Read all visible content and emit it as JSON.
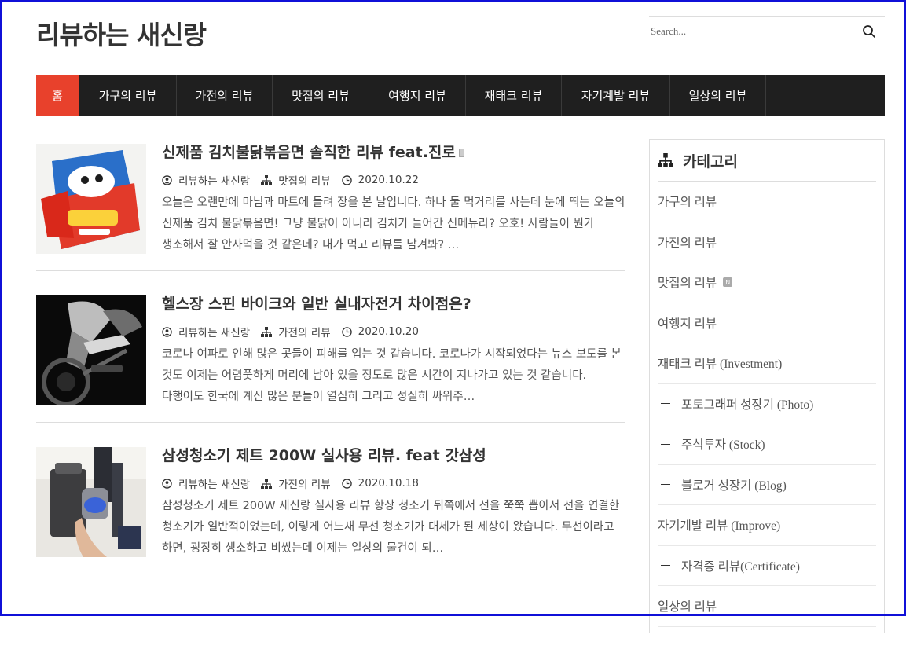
{
  "site": {
    "title": "리뷰하는 새신랑"
  },
  "search": {
    "placeholder": "Search..."
  },
  "nav": {
    "items": [
      {
        "label": "홈",
        "active": true
      },
      {
        "label": "가구의 리뷰"
      },
      {
        "label": "가전의 리뷰"
      },
      {
        "label": "맛집의 리뷰"
      },
      {
        "label": "여행지 리뷰"
      },
      {
        "label": "재태크 리뷰"
      },
      {
        "label": "자기계발 리뷰"
      },
      {
        "label": "일상의 리뷰"
      }
    ]
  },
  "posts": [
    {
      "title": "신제품 김치불닭볶음면 솔직한 리뷰 feat.진로",
      "author": "리뷰하는 새신랑",
      "category": "맛집의 리뷰",
      "date": "2020.10.22",
      "excerpt": "오늘은 오랜만에 마님과 마트에 들려 장을 본 날입니다. 하나 둘 먹거리를 사는데 눈에 띄는 오늘의 신제품 김치 불닭볶음면! 그냥 불닭이 아니라 김치가 들어간 신메뉴라? 오호! 사람들이 뭔가 생소해서 잘 안사먹을 것 같은데? 내가 먹고 리뷰를 남겨봐? …"
    },
    {
      "title": "헬스장 스핀 바이크와 일반 실내자전거 차이점은?",
      "author": "리뷰하는 새신랑",
      "category": "가전의 리뷰",
      "date": "2020.10.20",
      "excerpt": "코로나 여파로 인해 많은 곳들이 피해를 입는 것 같습니다. 코로나가 시작되었다는 뉴스 보도를 본 것도 이제는 어렴풋하게 머리에 남아 있을 정도로 많은 시간이 지나가고 있는 것 같습니다. 다행이도 한국에 계신 많은 분들이 열심히 그리고 성실히 싸워주…"
    },
    {
      "title": "삼성청소기 제트 200W 실사용 리뷰. feat 갓삼성",
      "author": "리뷰하는 새신랑",
      "category": "가전의 리뷰",
      "date": "2020.10.18",
      "excerpt": "삼성청소기 제트 200W 새신랑 실사용 리뷰 항상 청소기 뒤쪽에서 선을 쭉쭉 뽑아서 선을 연결한 청소기가 일반적이었는데, 이렇게 어느새 무선 청소기가 대세가 된 세상이 왔습니다. 무선이라고 하면, 굉장히 생소하고 비쌌는데 이제는 일상의 물건이 되…"
    }
  ],
  "sidebar": {
    "title": "카테고리",
    "categories": [
      {
        "label": "가구의 리뷰"
      },
      {
        "label": "가전의 리뷰"
      },
      {
        "label": "맛집의 리뷰",
        "badge": "N"
      },
      {
        "label": "여행지 리뷰"
      },
      {
        "label": "재태크 리뷰 (Investment)"
      },
      {
        "label": "포토그래퍼 성장기 (Photo)",
        "sub": true
      },
      {
        "label": "주식투자 (Stock)",
        "sub": true
      },
      {
        "label": "블로거 성장기 (Blog)",
        "sub": true
      },
      {
        "label": "자기계발 리뷰 (Improve)"
      },
      {
        "label": "자격증 리뷰(Certificate)",
        "sub": true
      },
      {
        "label": "일상의 리뷰"
      }
    ]
  },
  "colors": {
    "accent": "#e8412c",
    "nav_bg": "#1f1f1f",
    "frame": "#1010d8"
  }
}
